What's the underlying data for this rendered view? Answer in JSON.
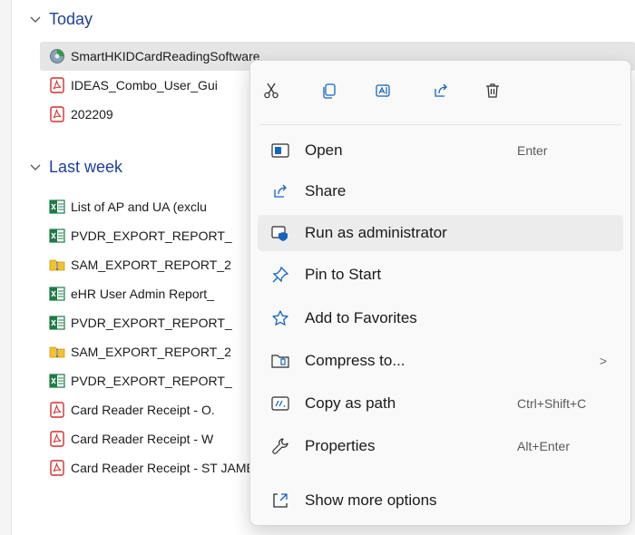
{
  "groups": {
    "today": "Today",
    "last_week": "Last week"
  },
  "files": [
    {
      "name": "SmartHKIDCardReadingSoftware",
      "icon": "installer-icon"
    },
    {
      "name": "IDEAS_Combo_User_Gui",
      "icon": "pdf-icon"
    },
    {
      "name": "202209",
      "icon": "pdf-icon"
    },
    {
      "name": "List of AP and UA (exclu",
      "icon": "excel-icon"
    },
    {
      "name": "PVDR_EXPORT_REPORT_",
      "icon": "excel-icon"
    },
    {
      "name": "SAM_EXPORT_REPORT_2",
      "icon": "zip-folder-icon"
    },
    {
      "name": "eHR User Admin Report_",
      "icon": "excel-icon"
    },
    {
      "name": "PVDR_EXPORT_REPORT_",
      "icon": "excel-icon"
    },
    {
      "name": "SAM_EXPORT_REPORT_2",
      "icon": "zip-folder-icon"
    },
    {
      "name": "PVDR_EXPORT_REPORT_",
      "icon": "excel-icon"
    },
    {
      "name": "Card Reader Receipt - O.",
      "icon": "pdf-icon"
    },
    {
      "name": "Card Reader Receipt - W",
      "icon": "pdf-icon"
    },
    {
      "name": "Card Reader Receipt - ST JAMES' SETTLEMENT",
      "icon": "pdf-icon"
    }
  ],
  "context_menu": {
    "toolbar": [
      "Cut",
      "Copy",
      "Rename",
      "Share",
      "Delete"
    ],
    "items": [
      {
        "label": "Open",
        "shortcut": "Enter"
      },
      {
        "label": "Share",
        "shortcut": ""
      },
      {
        "label": "Run as administrator",
        "shortcut": ""
      },
      {
        "label": "Pin to Start",
        "shortcut": ""
      },
      {
        "label": "Add to Favorites",
        "shortcut": ""
      },
      {
        "label": "Compress to...",
        "shortcut": "",
        "submenu_arrow": ">"
      },
      {
        "label": "Copy as path",
        "shortcut": "Ctrl+Shift+C"
      },
      {
        "label": "Properties",
        "shortcut": "Alt+Enter"
      },
      {
        "label": "Show more options",
        "shortcut": ""
      }
    ]
  },
  "colors": {
    "group_header": "#1f3f9a",
    "selection": "#e5e5e5",
    "menu_bg": "#f9f9f9",
    "accent_blue": "#1565c0",
    "pdf_red": "#d32f2f",
    "excel_green": "#1e7b45"
  }
}
